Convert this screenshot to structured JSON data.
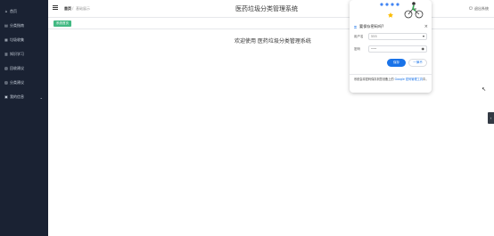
{
  "sidebar": {
    "items": [
      {
        "label": "首页",
        "icon": "home-icon",
        "glyph": "⌂"
      },
      {
        "label": "分类指南",
        "icon": "guide-icon",
        "glyph": "▤"
      },
      {
        "label": "垃圾收集",
        "icon": "bin-icon",
        "glyph": "▦"
      },
      {
        "label": "知识学习",
        "icon": "book-icon",
        "glyph": "▥"
      },
      {
        "label": "回收建议",
        "icon": "bulb-icon",
        "glyph": "▧"
      },
      {
        "label": "分类建议",
        "icon": "chart-icon",
        "glyph": "▨"
      },
      {
        "label": "我的信息",
        "icon": "user-icon",
        "glyph": "▣"
      }
    ]
  },
  "header": {
    "breadcrumb_home": "首页",
    "breadcrumb_sep": "/",
    "breadcrumb_current": "基础展示",
    "title": "医药垃圾分类管理系统",
    "logout": "退出系统"
  },
  "tabs": {
    "active": "系统首页"
  },
  "main": {
    "welcome": "欢迎使用 医药垃圾分类管理系统"
  },
  "password_popup": {
    "title": "要保存密码吗?",
    "username_label": "用户名",
    "username_value": "555",
    "password_label": "密码",
    "password_value": "•••",
    "save_label": "保存",
    "never_label": "一律不",
    "footer_text": "系统会将密码保存到您设备上的 Google 密码管理工具中。",
    "footer_prefix": "系统会将密码保存到您设备上的",
    "footer_link": "Google 密码管理工具",
    "footer_suffix": "中。"
  },
  "colors": {
    "sidebar_bg": "#1a2233",
    "accent_green": "#42b983",
    "chrome_blue": "#1a73e8"
  }
}
